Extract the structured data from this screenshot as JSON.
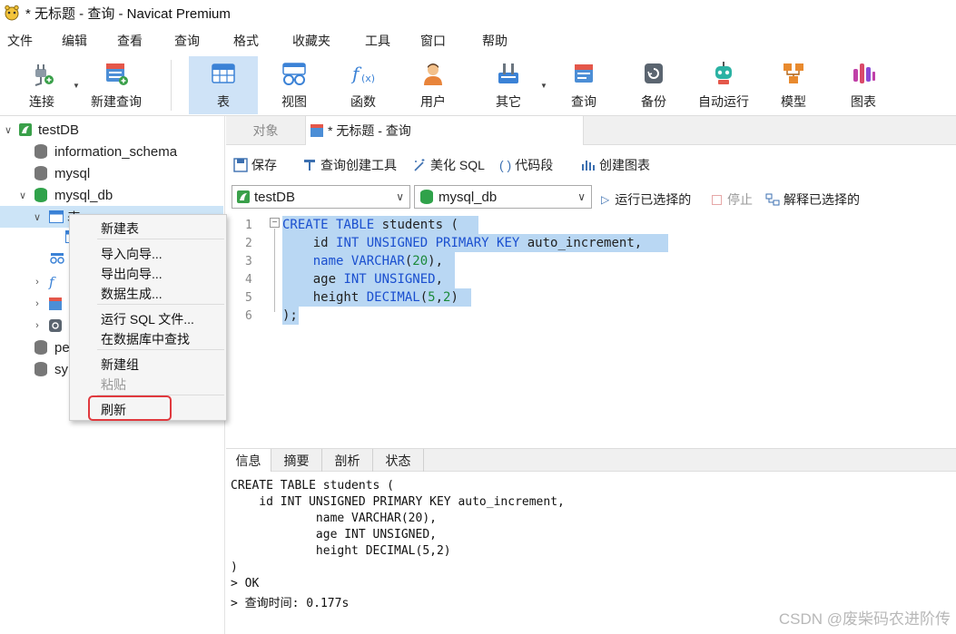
{
  "window": {
    "title": "* 无标题 - 查询 - Navicat Premium"
  },
  "menu": [
    "文件",
    "编辑",
    "查看",
    "查询",
    "格式",
    "收藏夹",
    "工具",
    "窗口",
    "帮助"
  ],
  "toolbar": {
    "connect": "连接",
    "new_query": "新建查询",
    "table": "表",
    "view": "视图",
    "function": "函数",
    "user": "用户",
    "other": "其它",
    "query": "查询",
    "backup": "备份",
    "automation": "自动运行",
    "model": "模型",
    "chart": "图表"
  },
  "tree": {
    "root": "testDB",
    "items": [
      "information_schema",
      "mysql",
      "mysql_db"
    ],
    "collapsed_row_1": "表",
    "partial_1": "pe",
    "partial_2": "sy"
  },
  "context_menu": {
    "new_table": "新建表",
    "import_wizard": "导入向导...",
    "export_wizard": "导出向导...",
    "data_gen": "数据生成...",
    "run_sql": "运行 SQL 文件...",
    "find_in_db": "在数据库中查找",
    "new_group": "新建组",
    "paste": "粘贴",
    "refresh": "刷新"
  },
  "tabs": {
    "objects": "对象",
    "query_tab": "* 无标题 - 查询"
  },
  "query_toolbar": {
    "save": "保存",
    "builder": "查询创建工具",
    "beautify": "美化 SQL",
    "snippet": "代码段",
    "create_chart": "创建图表",
    "run_selected": "运行已选择的",
    "stop": "停止",
    "explain": "解释已选择的"
  },
  "connection_combo": "testDB",
  "database_combo": "mysql_db",
  "editor": {
    "line_numbers": [
      "1",
      "2",
      "3",
      "4",
      "5",
      "6"
    ]
  },
  "bottom_tabs": [
    "信息",
    "摘要",
    "剖析",
    "状态"
  ],
  "output_lines": [
    "CREATE TABLE students (",
    "    id INT UNSIGNED PRIMARY KEY auto_increment,",
    "            name VARCHAR(20),",
    "            age INT UNSIGNED,",
    "            height DECIMAL(5,2)",
    ")",
    "> OK",
    "> 查询时间: 0.177s"
  ],
  "watermark": "CSDN @废柴码农进阶传"
}
